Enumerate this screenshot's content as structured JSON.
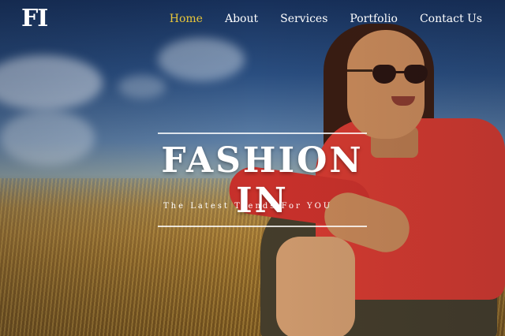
{
  "logo": {
    "text": "FI"
  },
  "nav": {
    "items": [
      {
        "label": "Home",
        "active": true
      },
      {
        "label": "About",
        "active": false
      },
      {
        "label": "Services",
        "active": false
      },
      {
        "label": "Portfolio",
        "active": false
      },
      {
        "label": "Contact Us",
        "active": false
      }
    ]
  },
  "hero": {
    "title": "FASHION IN",
    "tagline": "The Latest Trends For YOU"
  },
  "colors": {
    "nav_active": "#e8c63a",
    "nav_text": "#ffffff",
    "sky": "#2a4e80",
    "shirt": "#d43a30"
  }
}
